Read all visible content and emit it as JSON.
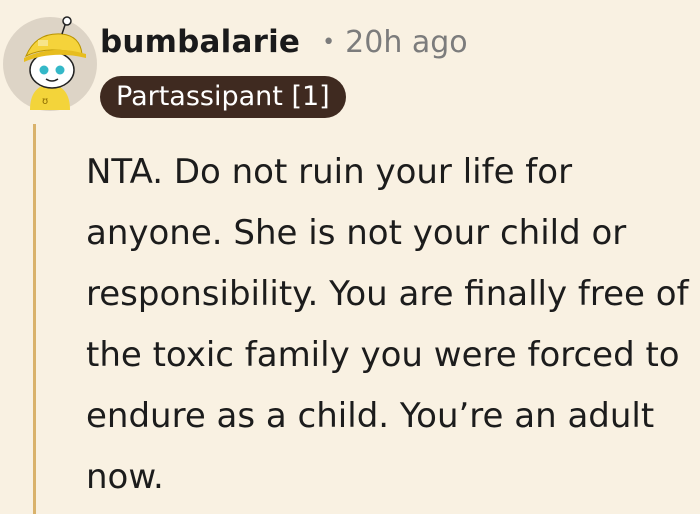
{
  "comment": {
    "username": "bumbalarie",
    "separator": "•",
    "timestamp": "20h ago",
    "flair": "Partassipant [1]",
    "avatar_icon": "snoo-yellow-hat-avatar-icon",
    "body": "NTA. Do not ruin your life for anyone. She is not your child or responsibility. You are finally free of the toxic family you were forced to endure as a child. You’re an adult now."
  },
  "colors": {
    "background": "#f9f1e2",
    "flair_background": "#3f2a20",
    "thread_line": "#d9b26b",
    "meta_text": "#7c7c7c"
  }
}
